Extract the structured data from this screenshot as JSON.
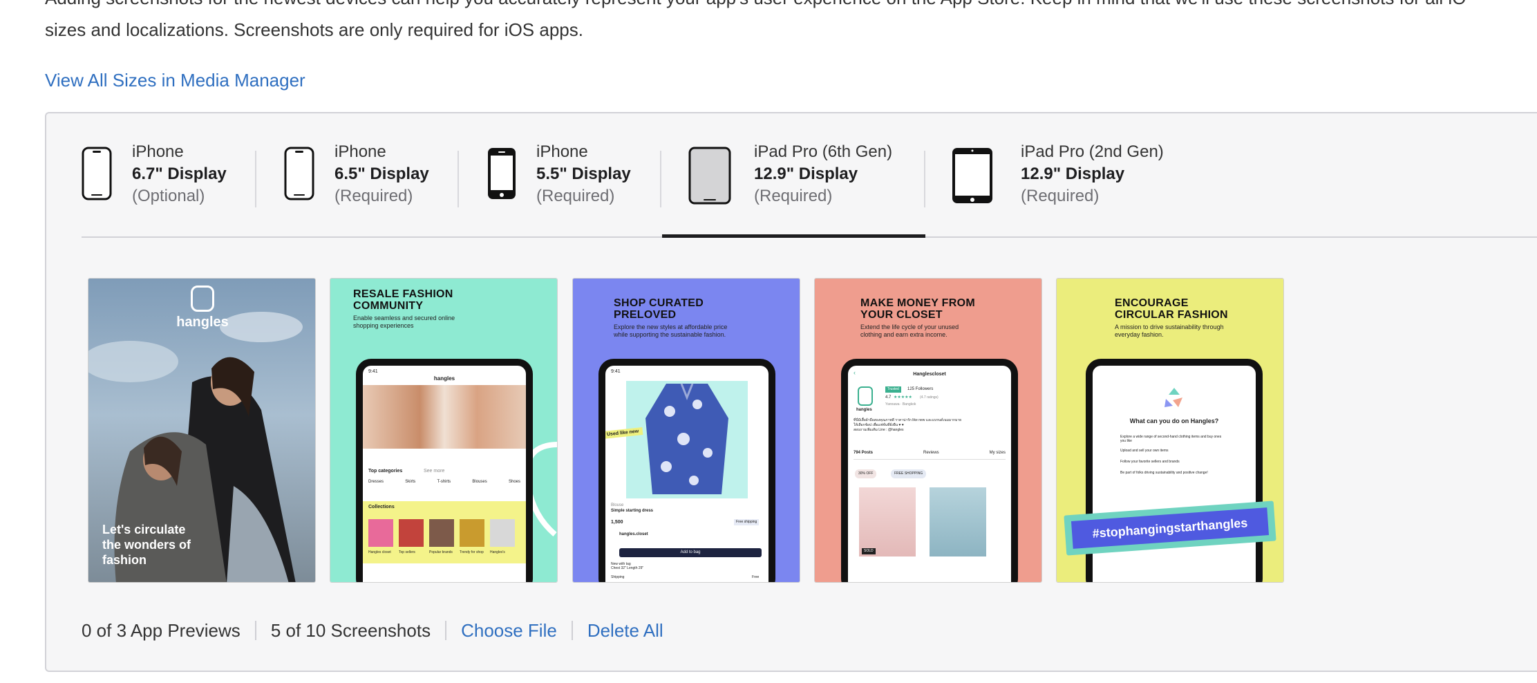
{
  "intro": {
    "line1": "Adding screenshots for the newest devices can help you accurately represent your app's user experience on the App Store. Keep in mind that we'll use these screenshots for all iO",
    "line2": "sizes and localizations. Screenshots are only required for iOS apps."
  },
  "media_manager_link": "View All Sizes in Media Manager",
  "device_tabs": [
    {
      "line1": "iPhone",
      "line2": "6.7\" Display",
      "line3": "(Optional)",
      "icon": "iphone-icon"
    },
    {
      "line1": "iPhone",
      "line2": "6.5\" Display",
      "line3": "(Required)",
      "icon": "iphone-icon"
    },
    {
      "line1": "iPhone",
      "line2": "5.5\" Display",
      "line3": "(Required)",
      "icon": "iphone-home-button-icon"
    },
    {
      "line1": "iPad Pro (6th Gen)",
      "line2": "12.9\" Display",
      "line3": "(Required)",
      "icon": "ipad-icon",
      "selected": true
    },
    {
      "line1": "iPad Pro (2nd Gen)",
      "line2": "12.9\" Display",
      "line3": "(Required)",
      "icon": "ipad-home-button-icon"
    }
  ],
  "screenshots": [
    {
      "bg": "#8fa9c2",
      "brand": "hangles",
      "caption": "Let's circulate\nthe wonders of\nfashion"
    },
    {
      "bg": "#8eead2",
      "title": "RESALE FASHION\nCOMMUNITY",
      "subtitle": "Enable seamless and secured online\nshopping experiences",
      "screen": {
        "time": "9:41",
        "brand": "hangles",
        "section1": "Top categories",
        "see_more": "See more",
        "categories": [
          "Dresses",
          "Skirts",
          "T-shirts",
          "Blouses",
          "Shoes"
        ],
        "section2": "Collections",
        "collections": [
          "Hangles closet",
          "Top sellers",
          "Popular brands",
          "Trendy for shop",
          "Hangles's"
        ]
      }
    },
    {
      "bg": "#7b86f0",
      "title": "SHOP CURATED\nPRELOVED",
      "subtitle": "Explore the new styles at affordable price\nwhile supporting the sustainable fashion.",
      "screen": {
        "time": "9:41",
        "tag": "Used like new",
        "item_title": "Blouse",
        "item_name": "Simple starting dress",
        "price": "1,500",
        "shipping_badge": "Free shipping",
        "seller": "hangles.closet",
        "button": "Add to bag",
        "details": "New with tag\nChest 32\" Length 29\"",
        "shipping_label": "Shipping",
        "shipping_value": "Free"
      }
    },
    {
      "bg": "#ef9d8e",
      "title": "MAKE MONEY FROM\nYOUR CLOSET",
      "subtitle": "Extend the life cycle of your unused\nclothing and earn extra income.",
      "screen": {
        "shop_name": "Hanglescloset",
        "badge": "Trusted",
        "followers": "125 Followers",
        "rating": "4.7",
        "ratings_count": "(4.7 ratings)",
        "location": "Yannawa · Bangkok",
        "brand": "hangles",
        "bio": "ที่นี่มีเสื้อผ้ามือสองคุณภาพดี ราคาน่ารัก like new และแบรนด์เนมมากมาย\nให้เลือกช้อป เพื่อแฟชั่นที่ยั่งยืน ♥ ♥\nสอบถามเพิ่มเติม Line : @hangles",
        "tabs": [
          "794 Posts",
          "Reviews",
          "My sizes"
        ],
        "chips": [
          "30% OFF",
          "FREE SHOPPING"
        ],
        "sold": "SOLD"
      }
    },
    {
      "bg": "#ebed7c",
      "title": "ENCOURAGE\nCIRCULAR FASHION",
      "subtitle": "A mission to drive sustainability through\neveryday fashion.",
      "screen": {
        "question": "What can you do on Hangles?",
        "items": [
          "Explore a wide range of second-hand clothing items and buy ones you like",
          "Upload and sell your own items",
          "Follow your favorite sellers and brands",
          "Be part of folks driving sustainability and positive change!"
        ]
      },
      "hashtag": "#stophangingstarthangles"
    }
  ],
  "footer": {
    "previews": "0 of 3 App Previews",
    "screenshots": "5 of 10 Screenshots",
    "choose_file": "Choose File",
    "delete_all": "Delete All"
  },
  "colors": {
    "link": "#2f6fc0",
    "panel_bg": "#f6f6f7",
    "text": "#1d1d1f"
  }
}
